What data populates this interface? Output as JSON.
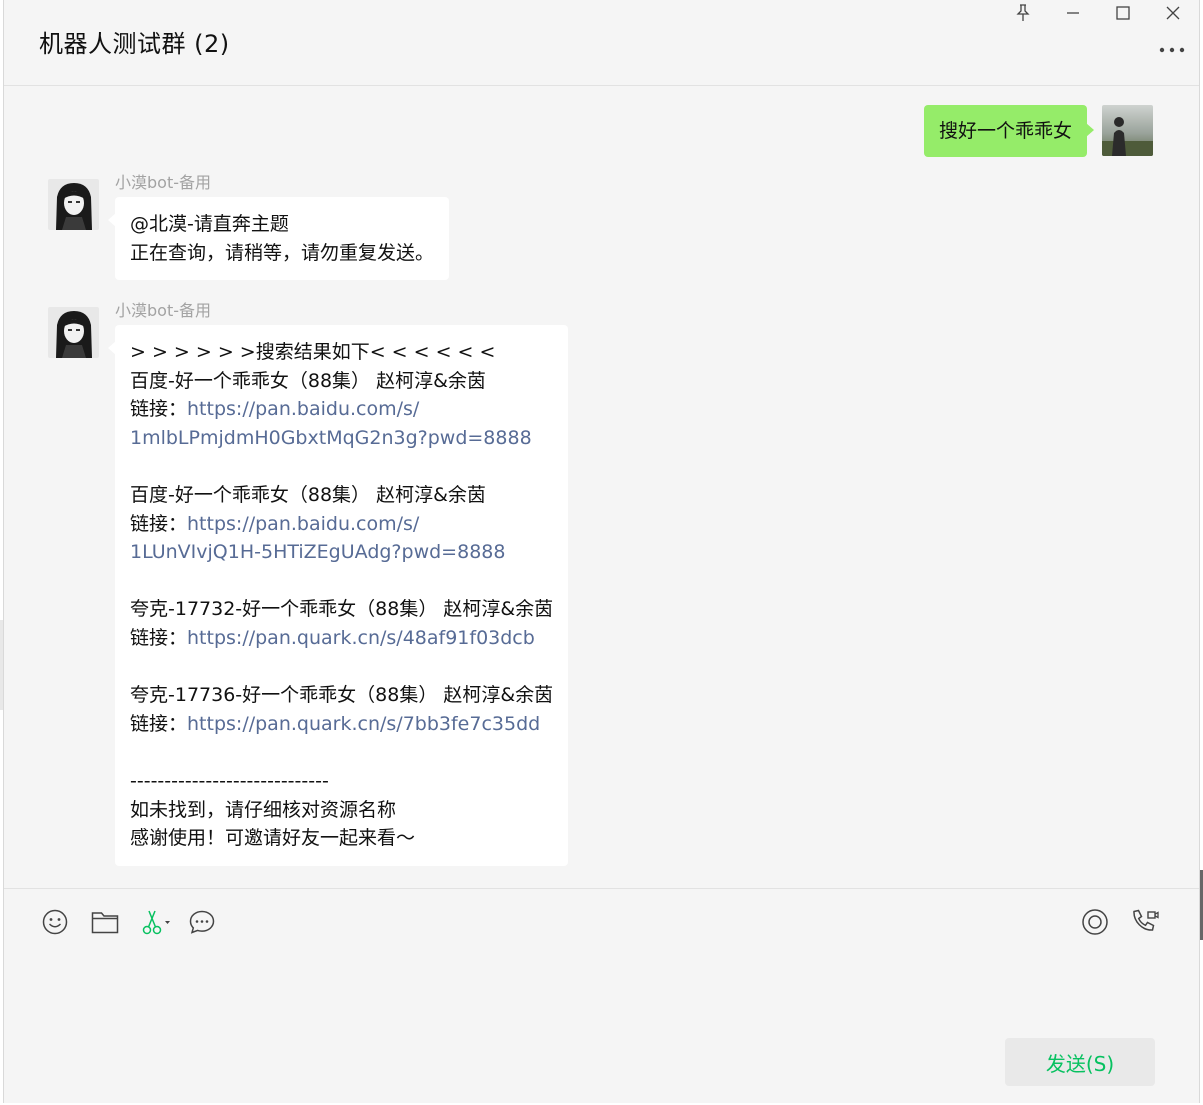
{
  "window": {
    "title": "机器人测试群 (2)"
  },
  "messages": {
    "outgoing": {
      "text": "搜好一个乖乖女"
    },
    "incoming1": {
      "sender": "小漠bot-备用",
      "lines": [
        "@北漠-请直奔主题",
        "正在查询，请稍等，请勿重复发送。"
      ]
    },
    "incoming2": {
      "sender": "小漠bot-备用",
      "header": "> > > > > >搜索结果如下< < < < < <",
      "results": [
        {
          "title": "百度-好一个乖乖女（88集） 赵柯淳&余茵",
          "label": "链接：",
          "url_line1": "https://pan.baidu.com/s/",
          "url_line2": "1mlbLPmjdmH0GbxtMqG2n3g?pwd=8888"
        },
        {
          "title": "百度-好一个乖乖女（88集） 赵柯淳&余茵",
          "label": "链接：",
          "url_line1": "https://pan.baidu.com/s/",
          "url_line2": "1LUnVIvjQ1H-5HTiZEgUAdg?pwd=8888"
        },
        {
          "title": "夸克-17732-好一个乖乖女（88集） 赵柯淳&余茵",
          "label": "链接：",
          "url_line1": "https://pan.quark.cn/s/48af91f03dcb"
        },
        {
          "title": "夸克-17736-好一个乖乖女（88集） 赵柯淳&余茵",
          "label": "链接：",
          "url_line1": "https://pan.quark.cn/s/7bb3fe7c35dd"
        }
      ],
      "divider": "-----------------------------",
      "footer1": "如未找到，请仔细核对资源名称",
      "footer2": "感谢使用！可邀请好友一起来看～"
    }
  },
  "input": {
    "send_label": "发送(S)"
  },
  "icons": {
    "pin": "pin-icon",
    "minimize": "minimize-icon",
    "maximize": "maximize-icon",
    "close": "close-icon",
    "more": "more-icon",
    "emoji": "emoji-icon",
    "file": "folder-icon",
    "screenshot": "scissors-icon",
    "history": "chat-history-icon",
    "live": "live-icon",
    "call": "voice-video-call-icon"
  },
  "colors": {
    "green_bubble": "#95ec69",
    "link": "#576b95",
    "send_text": "#07c160",
    "background": "#f5f5f5"
  }
}
